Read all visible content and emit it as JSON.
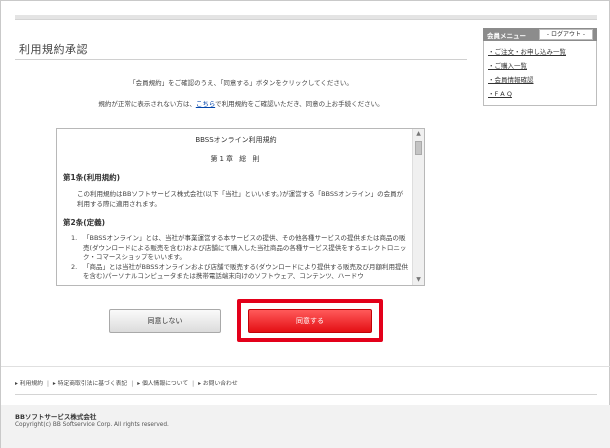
{
  "page": {
    "title": "利用規約承認",
    "intro_line1": "「会員規約」をご確認のうえ、「同意する」ボタンをクリックしてください。",
    "intro_line2_before": "規約が正常に表示されない方は、",
    "intro_line2_link": "こちら",
    "intro_line2_after": "で利用規約をご確認いただき、同意の上お手続ください。"
  },
  "terms": {
    "title": "BBSSオンライン利用規約",
    "chapter": "第1章 総 則",
    "sections": [
      {
        "heading": "第1条(利用規約)",
        "body": "この利用規約はBBソフトサービス株式会社(以下「当社」といいます。)が運営する「BBSSオンライン」の会員が利用する際に適用されます。"
      },
      {
        "heading": "第2条(定義)",
        "items": [
          "「BBSSオンライン」とは、当社が事業運営する本サービスの提供、その他各種サービスの提供または商品の販売(ダウンロードによる販売を含む)および店舗にて購入した当社商品の各種サービス提供をするエレクトロニック・コマースショップをいいます。",
          "「商品」とは当社がBBSSオンラインおよび店舗で販売する(ダウンロードにより提供する販売及び月額利用提供を含む)パーソナルコンピュータまたは携帯電話端末向けのソフトウェア、コンテンツ、ハードウ"
        ]
      }
    ]
  },
  "buttons": {
    "disagree": "同意しない",
    "agree": "同意する"
  },
  "sidebar": {
    "title": "会員メニュー",
    "logout": "- ログアウト -",
    "items": [
      "・ご注文・お申し込み一覧",
      "・ご購入一覧",
      "・会員情報確認",
      "・F A Q"
    ]
  },
  "footer": {
    "links": [
      "▸ 利用規約",
      "▸ 特定商取引法に基づく表記",
      "▸ 個人情報について",
      "▸ お問い合わせ"
    ],
    "company": "BBソフトサービス株式会社",
    "copyright": "Copyright(c) BB Softservice Corp. All rights reserved."
  },
  "colors": {
    "accent_red": "#e3001a",
    "sidebar_header": "#8c8c8c"
  }
}
